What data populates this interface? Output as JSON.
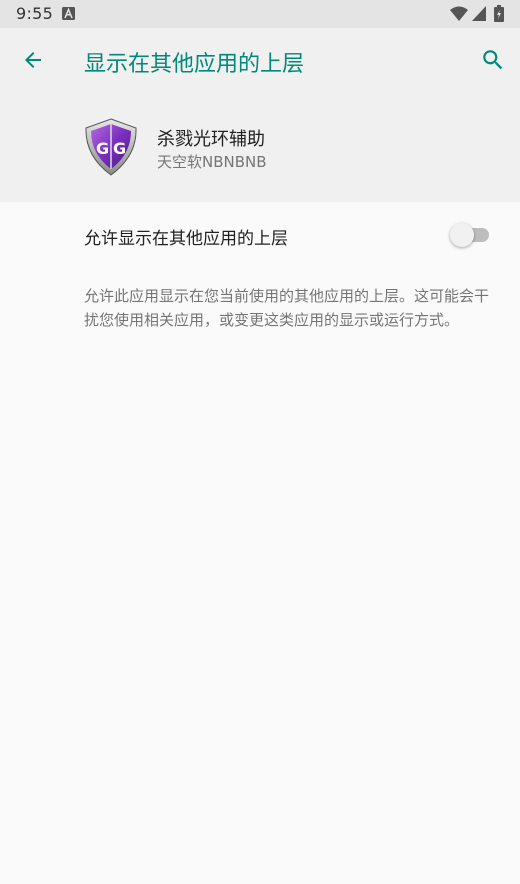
{
  "status_bar": {
    "time": "9:55",
    "icons": [
      "notification-a-icon",
      "wifi-icon",
      "signal-icon",
      "battery-icon"
    ]
  },
  "app_bar": {
    "title": "显示在其他应用的上层",
    "back_icon": "arrow-back-icon",
    "search_icon": "search-icon",
    "accent_color": "#00897b"
  },
  "app_info": {
    "name": "杀戮光环辅助",
    "developer": "天空软NBNBNB",
    "icon": "game-guardian-icon"
  },
  "permission": {
    "label": "允许显示在其他应用的上层",
    "enabled": false,
    "description": "允许此应用显示在您当前使用的其他应用的上层。这可能会干扰您使用相关应用，或变更这类应用的显示或运行方式。"
  }
}
